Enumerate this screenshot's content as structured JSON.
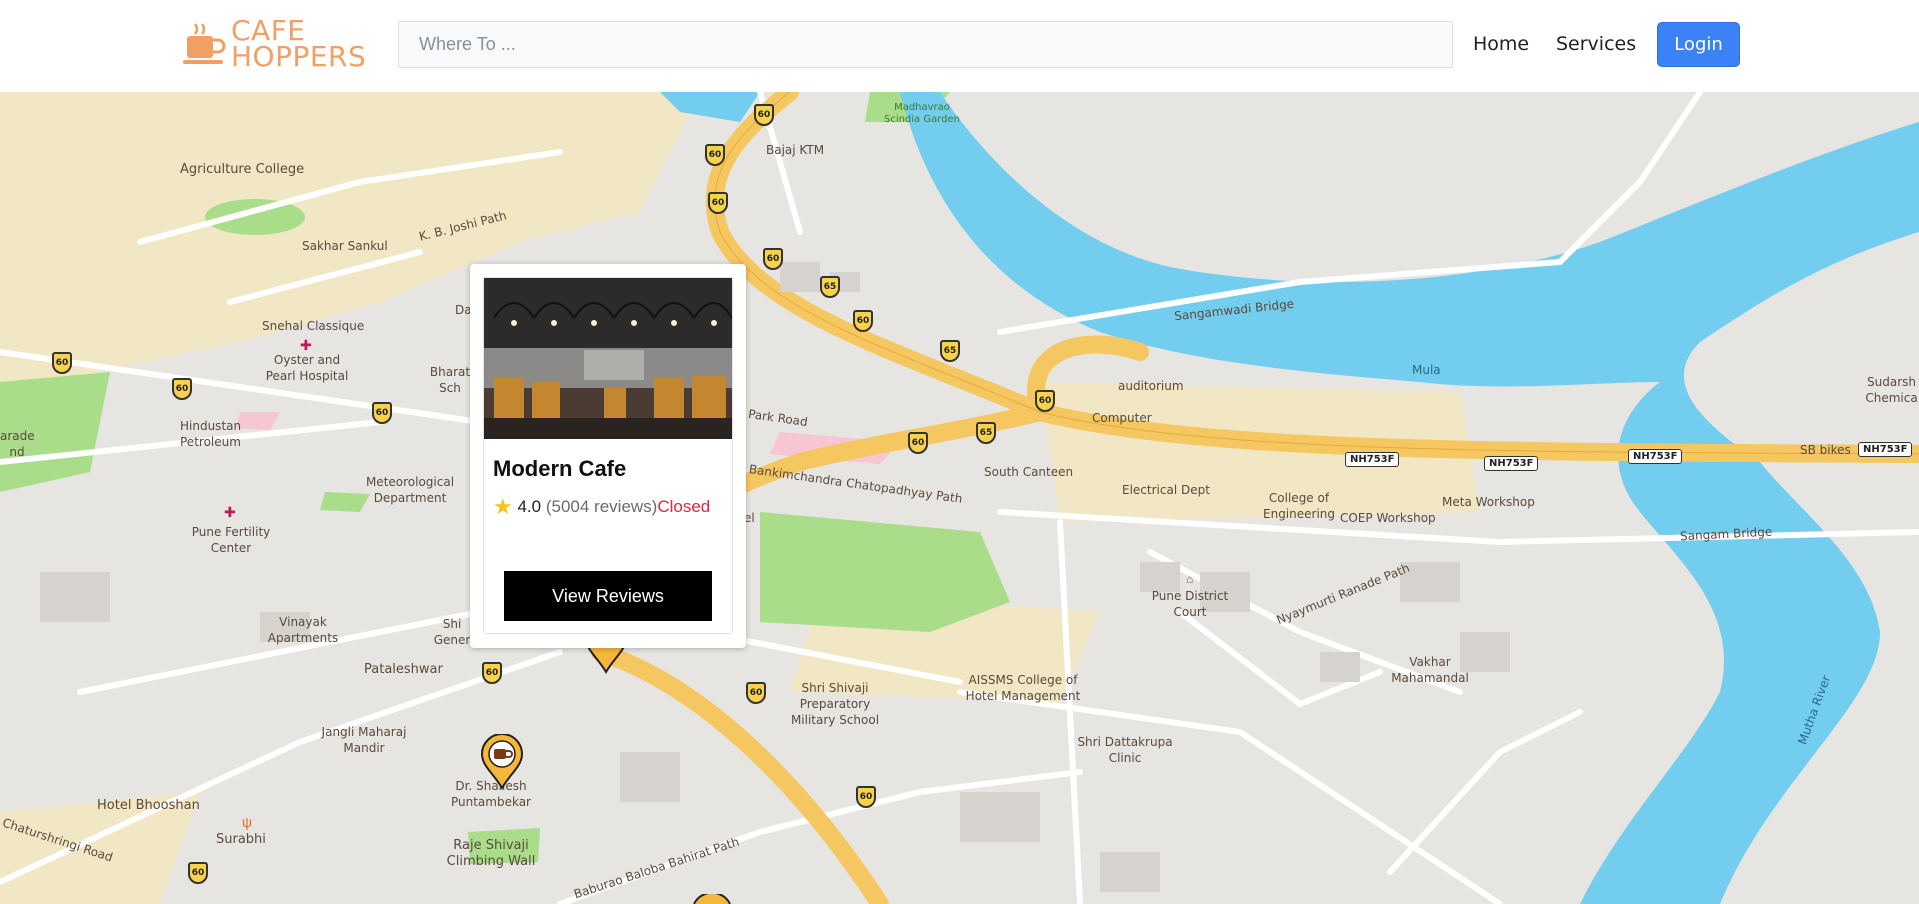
{
  "header": {
    "logo_line1": "CAFE",
    "logo_line2": "HOPPERS",
    "search_placeholder": "Where To ...",
    "nav": {
      "home": "Home",
      "services": "Services",
      "login": "Login"
    }
  },
  "popup": {
    "title": "Modern Cafe",
    "rating": "4.0",
    "reviews": "(5004 reviews)",
    "status": "Closed",
    "button": "View Reviews"
  },
  "map": {
    "labels": {
      "agriculture_college": "Agriculture College",
      "sakhar_sankul": "Sakhar Sankul",
      "snehal_classique": "Snehal Classique",
      "oyster_pearl": "Oyster and Pearl Hospital",
      "hindustan_petroleum": "Hindustan Petroleum",
      "meteorological": "Meteorological Department",
      "pune_fertility": "Pune Fertility Center",
      "vinayak": "Vinayak Apartments",
      "pataleshwar": "Pataleshwar",
      "jangli_maharaj": "Jangli Maharaj Mandir",
      "hotel_bhooshan": "Hotel Bhooshan",
      "surabhi": "Surabhi",
      "dr_shailesh": "Dr. Shailesh Puntambekar",
      "raje_shivaji": "Raje Shivaji Climbing Wall",
      "shri_shivaji": "Shri Shivaji Preparatory Military School",
      "aissms": "AISSMS College of Hotel Management",
      "shri_dattakrupa": "Shri Dattakrupa Clinic",
      "pune_district_court": "Pune District Court",
      "vakhar": "Vakhar Mahamandal",
      "south_canteen": "South Canteen",
      "electrical_dept": "Electrical Dept",
      "college_engg": "College of Engineering",
      "coep_workshop": "COEP Workshop",
      "meta_workshop": "Meta Workshop",
      "auditorium": "auditorium",
      "computer": "Computer",
      "sb_bikes": "SB bikes",
      "sudarshan": "Sudarsh Chemica",
      "bajaj": "Bajaj KTM",
      "madhavrao": "Madhavrao Scindia Garden",
      "sangamwadi_bridge": "Sangamwadi Bridge",
      "sangam_bridge": "Sangam Bridge",
      "mula": "Mula",
      "mutha_river": "Mutha River",
      "nyaymurti": "Nyaymurti Ranade Path",
      "bankimchandra": "Bankimchandra Chatopadhyay Path",
      "park_road": "Park Road",
      "kb_joshi": "K. B. Joshi Path",
      "chaturshringi": "Chaturshringi Road",
      "bahirat": "Baburao Baloba Bahirat Path",
      "parade": "arade nd",
      "bharat": "Bharat Sch",
      "shi_gener": "Shi Gener",
      "dal": "Dal",
      "el": "el"
    },
    "shields": [
      "60",
      "65",
      "NH753F"
    ]
  }
}
